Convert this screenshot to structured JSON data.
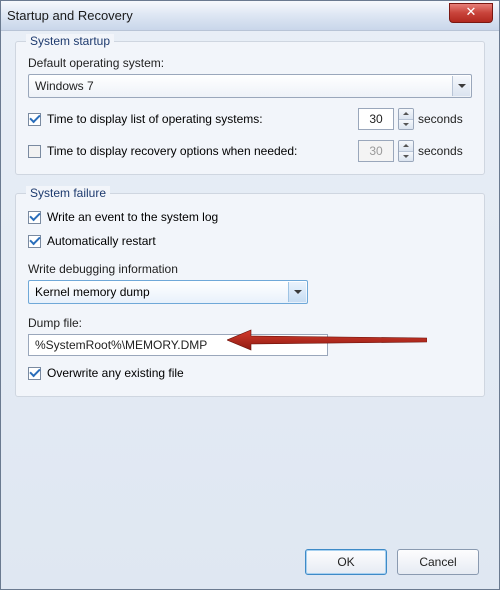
{
  "title": "Startup and Recovery",
  "startup": {
    "group_label": "System startup",
    "default_os_label": "Default operating system:",
    "default_os_value": "Windows 7",
    "display_list": {
      "checked": true,
      "label": "Time to display list of operating systems:",
      "value": "30",
      "unit": "seconds"
    },
    "display_recovery": {
      "checked": false,
      "label": "Time to display recovery options when needed:",
      "value": "30",
      "unit": "seconds"
    }
  },
  "failure": {
    "group_label": "System failure",
    "write_event": {
      "checked": true,
      "label": "Write an event to the system log"
    },
    "auto_restart": {
      "checked": true,
      "label": "Automatically restart"
    },
    "debug_label": "Write debugging information",
    "debug_value": "Kernel memory dump",
    "dump_label": "Dump file:",
    "dump_value": "%SystemRoot%\\MEMORY.DMP",
    "overwrite": {
      "checked": true,
      "label": "Overwrite any existing file"
    }
  },
  "buttons": {
    "ok": "OK",
    "cancel": "Cancel"
  }
}
